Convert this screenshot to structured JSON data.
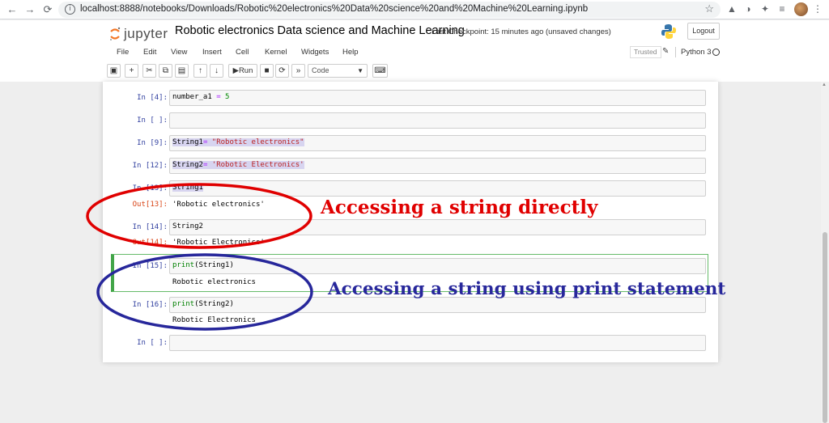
{
  "browser": {
    "back_icon": "←",
    "forward_icon": "→",
    "reload_icon": "⟳",
    "url": "localhost:8888/notebooks/Downloads/Robotic%20electronics%20Data%20science%20and%20Machine%20Learning.ipynb"
  },
  "header": {
    "logo_text": "jupyter",
    "notebook_title": "Robotic electronics Data science and Machine Learning",
    "checkpoint": "Last Checkpoint: 15 minutes ago  (unsaved changes)",
    "logout_label": "Logout"
  },
  "menu": {
    "items": [
      "File",
      "Edit",
      "View",
      "Insert",
      "Cell",
      "Kernel",
      "Widgets",
      "Help"
    ],
    "trusted_label": "Trusted",
    "kernel_name": "Python 3"
  },
  "toolbar": {
    "run_label": "Run",
    "cell_type": "Code"
  },
  "cells": [
    {
      "prompt": "In [4]:",
      "code_plain": "number_a1 ",
      "code_op": "=",
      "code_num": " 5"
    },
    {
      "prompt": "In [ ]:"
    },
    {
      "prompt": "In [9]:",
      "code_var": "String1",
      "code_op": "=",
      "code_str": " \"Robotic electronics\""
    },
    {
      "prompt": "In [12]:",
      "code_var": "String2",
      "code_op": "=",
      "code_str": " 'Robotic Electronics'"
    },
    {
      "prompt": "In [13]:",
      "code_var": "String1",
      "out_prompt": "Out[13]:",
      "output": "'Robotic electronics'"
    },
    {
      "prompt": "In [14]:",
      "code_var": "String2",
      "out_prompt": "Out[14]:",
      "output": "'Robotic Electronics'"
    },
    {
      "prompt": "In [15]:",
      "code_fn": "print",
      "code_args": "(String1)",
      "output": "Robotic electronics"
    },
    {
      "prompt": "In [16]:",
      "code_fn": "print",
      "code_args": "(String2)",
      "output": "Robotic Electronics"
    },
    {
      "prompt": "In [ ]:"
    }
  ],
  "annotations": {
    "red": "Accessing a string directly",
    "blue": "Accessing a string using print statement"
  },
  "colors": {
    "red_annotation": "#e00000",
    "blue_annotation": "#27279b",
    "in_prompt": "#303f9f",
    "out_prompt": "#d84315"
  }
}
